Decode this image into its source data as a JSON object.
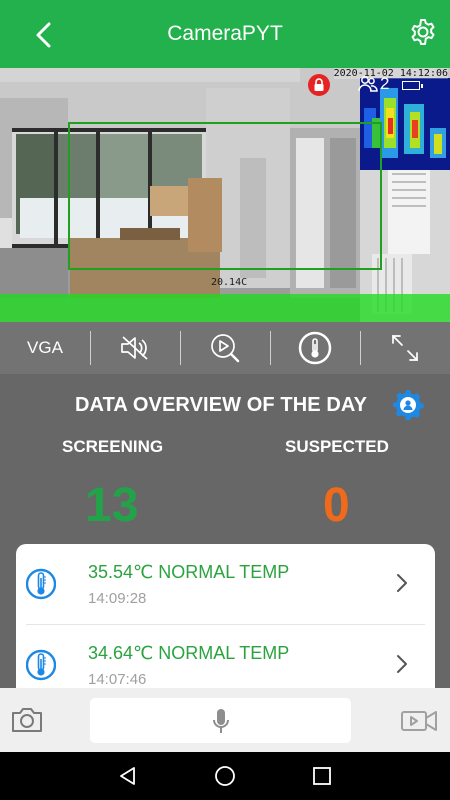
{
  "header": {
    "title": "CameraPYT",
    "back_icon": "back-chevron-icon",
    "settings_icon": "gear-icon"
  },
  "video": {
    "timestamp": "2020-11-02  14:12:06",
    "people_count": "2",
    "temp_readout": "20.14C",
    "status_icons": [
      "lock-icon",
      "people-icon",
      "battery-icon"
    ]
  },
  "toolbar": {
    "items": [
      {
        "label": "VGA",
        "icon": ""
      },
      {
        "label": "",
        "icon": "mute-speaker-icon"
      },
      {
        "label": "",
        "icon": "playback-search-icon"
      },
      {
        "label": "",
        "icon": "thermometer-icon"
      },
      {
        "label": "",
        "icon": "fullscreen-icon"
      }
    ]
  },
  "overview": {
    "title": "DATA OVERVIEW OF THE DAY",
    "screening_label": "SCREENING",
    "screening_value": "13",
    "suspected_label": "SUSPECTED",
    "suspected_value": "0"
  },
  "records": [
    {
      "title": "35.54℃ NORMAL TEMP",
      "time": "14:09:28"
    },
    {
      "title": "34.64℃ NORMAL TEMP",
      "time": "14:07:46"
    }
  ],
  "bottom": {
    "snapshot_icon": "camera-icon",
    "talk_icon": "microphone-icon",
    "record_icon": "video-camera-icon"
  },
  "colors": {
    "header_green": "#22b14c",
    "screening_green": "#22a34a",
    "suspected_orange": "#f06a1c",
    "record_green": "#2aa33f",
    "accent_blue": "#1e88e5"
  }
}
